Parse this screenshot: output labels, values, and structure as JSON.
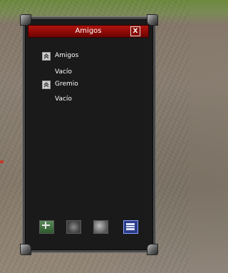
{
  "window": {
    "title": "Amigos",
    "close_label": "X",
    "groups": [
      {
        "label": "Amigos",
        "empty_label": "Vacío"
      },
      {
        "label": "Gremio",
        "empty_label": "Vacío"
      }
    ],
    "toolbar": [
      {
        "icon": "add-friend-icon"
      },
      {
        "icon": "remove-friend-icon"
      },
      {
        "icon": "options-icon"
      },
      {
        "icon": "info-icon"
      }
    ]
  }
}
